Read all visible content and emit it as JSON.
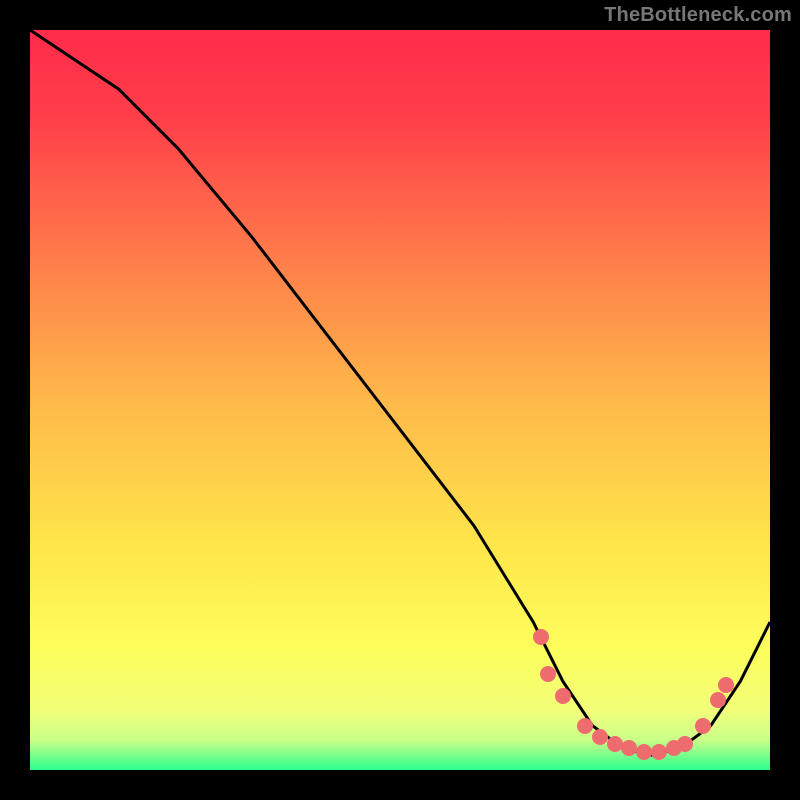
{
  "watermark": "TheBottleneck.com",
  "colors": {
    "frame_bg": "#000000",
    "gradient_stops": [
      {
        "pct": 0,
        "color": "#ff2b4a"
      },
      {
        "pct": 12,
        "color": "#ff3f4a"
      },
      {
        "pct": 30,
        "color": "#ff7a4a"
      },
      {
        "pct": 50,
        "color": "#ffb84a"
      },
      {
        "pct": 70,
        "color": "#ffe64a"
      },
      {
        "pct": 84,
        "color": "#fdff5d"
      },
      {
        "pct": 92,
        "color": "#f2ff7a"
      },
      {
        "pct": 96,
        "color": "#c9ff88"
      },
      {
        "pct": 100,
        "color": "#2bff8f"
      }
    ],
    "curve": "#000000",
    "dots": "#ee6b6e"
  },
  "chart_data": {
    "type": "line",
    "title": "",
    "xlabel": "",
    "ylabel": "",
    "xlim": [
      0,
      1
    ],
    "ylim": [
      0,
      1
    ],
    "grid": false,
    "legend": false,
    "series": [
      {
        "name": "curve",
        "x": [
          0.0,
          0.03,
          0.12,
          0.2,
          0.3,
          0.4,
          0.5,
          0.6,
          0.68,
          0.72,
          0.76,
          0.8,
          0.84,
          0.88,
          0.92,
          0.96,
          1.0
        ],
        "y": [
          1.0,
          0.98,
          0.92,
          0.84,
          0.72,
          0.59,
          0.46,
          0.33,
          0.2,
          0.12,
          0.06,
          0.03,
          0.02,
          0.03,
          0.06,
          0.12,
          0.2
        ]
      }
    ],
    "markers": {
      "name": "dots",
      "x": [
        0.69,
        0.7,
        0.72,
        0.75,
        0.77,
        0.79,
        0.81,
        0.83,
        0.85,
        0.87,
        0.885,
        0.91,
        0.93,
        0.94
      ],
      "y": [
        0.18,
        0.13,
        0.1,
        0.06,
        0.045,
        0.035,
        0.03,
        0.025,
        0.025,
        0.03,
        0.035,
        0.06,
        0.095,
        0.115
      ]
    },
    "annotations": [
      {
        "text": "TheBottleneck.com",
        "position": "top-right"
      }
    ]
  }
}
